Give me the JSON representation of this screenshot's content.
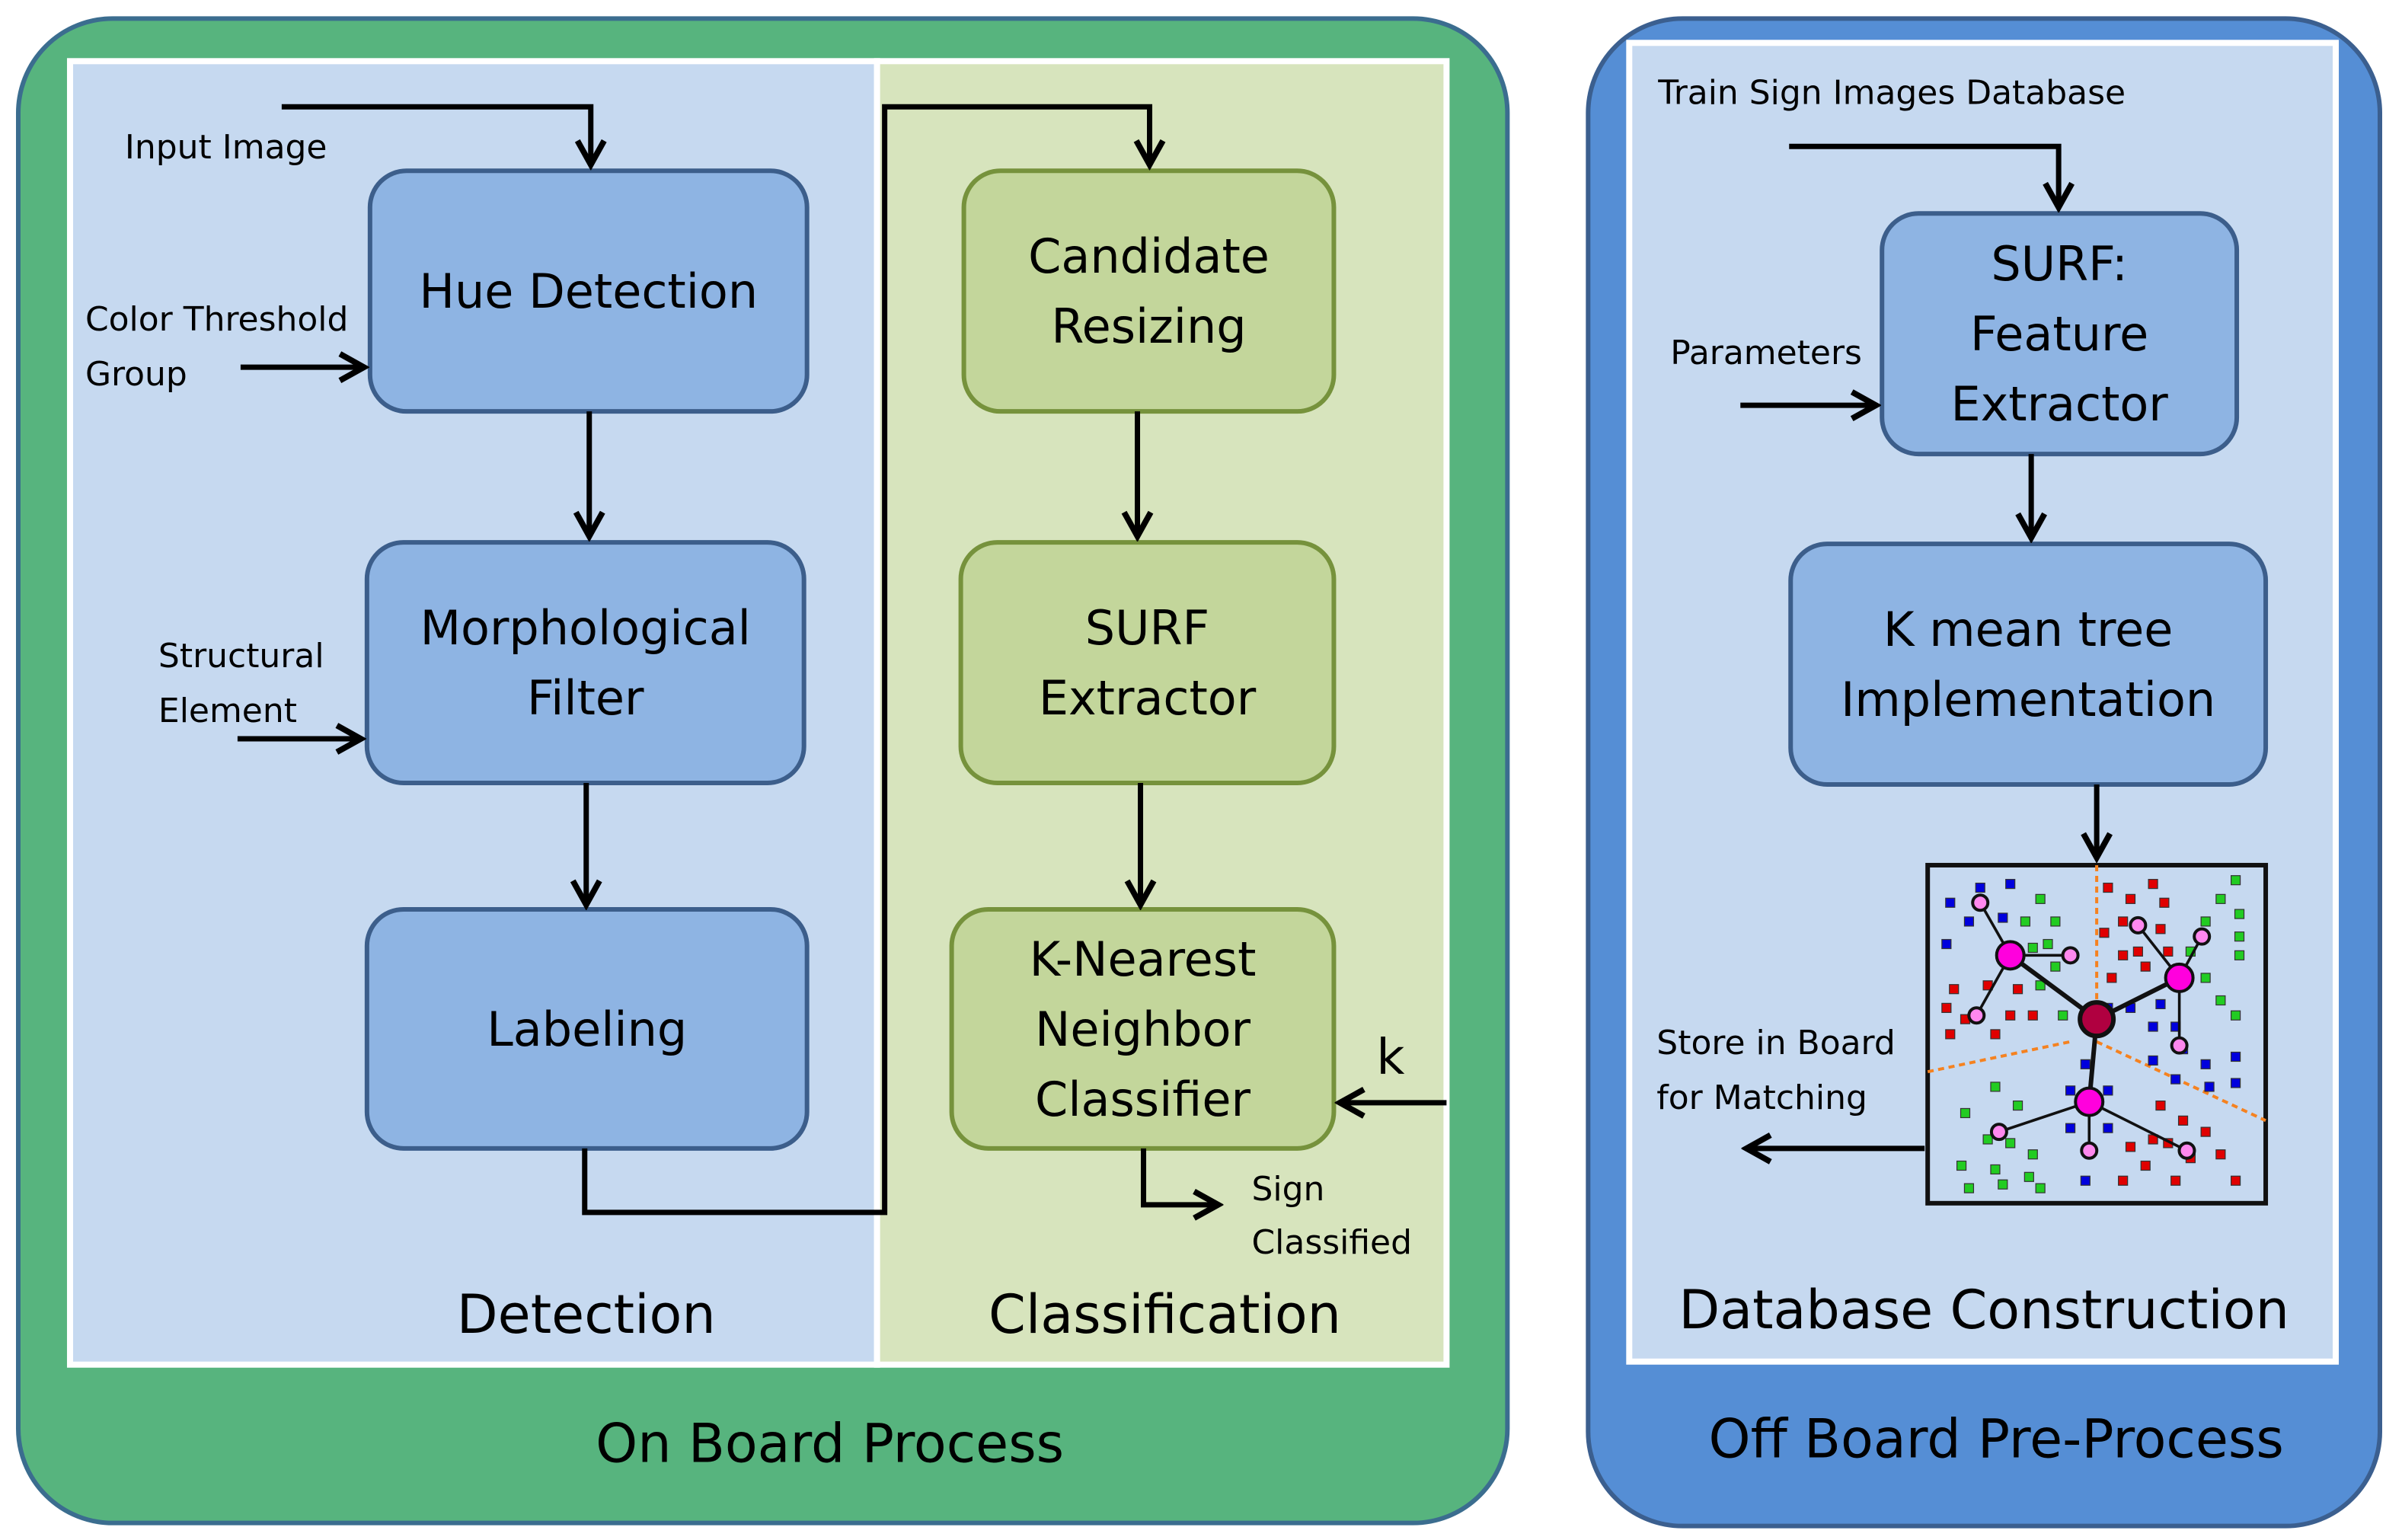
{
  "on_board": {
    "title": "On Board Process",
    "detection": {
      "title": "Detection",
      "input_image": "Input Image",
      "color_threshold": [
        "Color Threshold",
        "Group"
      ],
      "structural_element": [
        "Structural",
        "Element"
      ],
      "boxes": [
        {
          "lines": [
            "Hue Detection"
          ]
        },
        {
          "lines": [
            "Morphological",
            "Filter"
          ]
        },
        {
          "lines": [
            "Labeling"
          ]
        }
      ]
    },
    "classification": {
      "title": "Classification",
      "k_label": "k",
      "sign_classified": [
        "Sign",
        "Classified"
      ],
      "boxes": [
        {
          "lines": [
            "Candidate",
            "Resizing"
          ]
        },
        {
          "lines": [
            "SURF",
            "Extractor"
          ]
        },
        {
          "lines": [
            "K-Nearest",
            "Neighbor",
            "Classifier"
          ]
        }
      ]
    }
  },
  "off_board": {
    "title": "Off Board Pre-Process",
    "database": {
      "title": "Database Construction",
      "train_db": "Train Sign Images Database",
      "parameters": "Parameters",
      "store": [
        "Store in Board",
        "for Matching"
      ],
      "boxes": [
        {
          "lines": [
            "SURF:",
            "Feature",
            "Extractor"
          ]
        },
        {
          "lines": [
            "K mean tree",
            "Implementation"
          ]
        }
      ]
    }
  },
  "colors": {
    "on_board_bg": "#57b47e",
    "off_board_bg": "#558ed5",
    "detection_bg": "#c6d9f0",
    "classification_bg": "#d7e4bd",
    "blue_box": "#8eb4e3",
    "green_box": "#c3d69b"
  }
}
